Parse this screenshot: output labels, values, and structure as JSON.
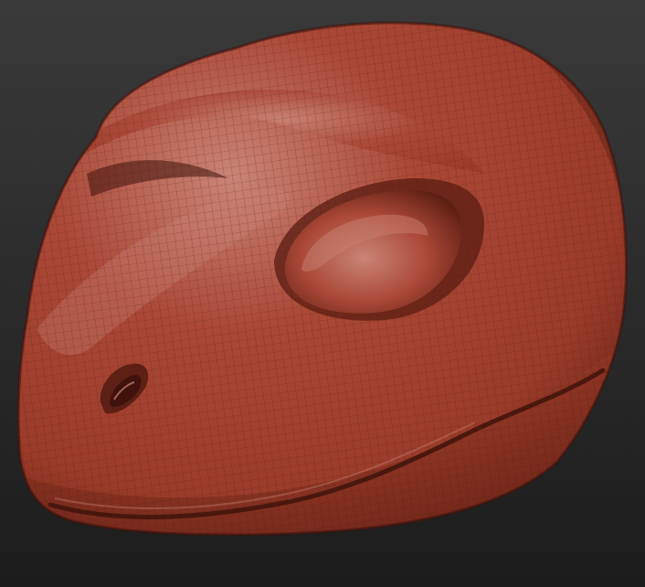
{
  "viewport": {
    "background_top": "#3a3a3a",
    "background_bottom": "#1c1c1c"
  },
  "model": {
    "subject": "reptile-head-sculpt",
    "material": {
      "base": "#9b3b29",
      "highlight": "#c98577",
      "mid": "#ab4837",
      "shadow": "#5e1f14",
      "deep_shadow": "#3f130b",
      "wire": "#4a150d"
    },
    "wireframe_visible": true
  }
}
